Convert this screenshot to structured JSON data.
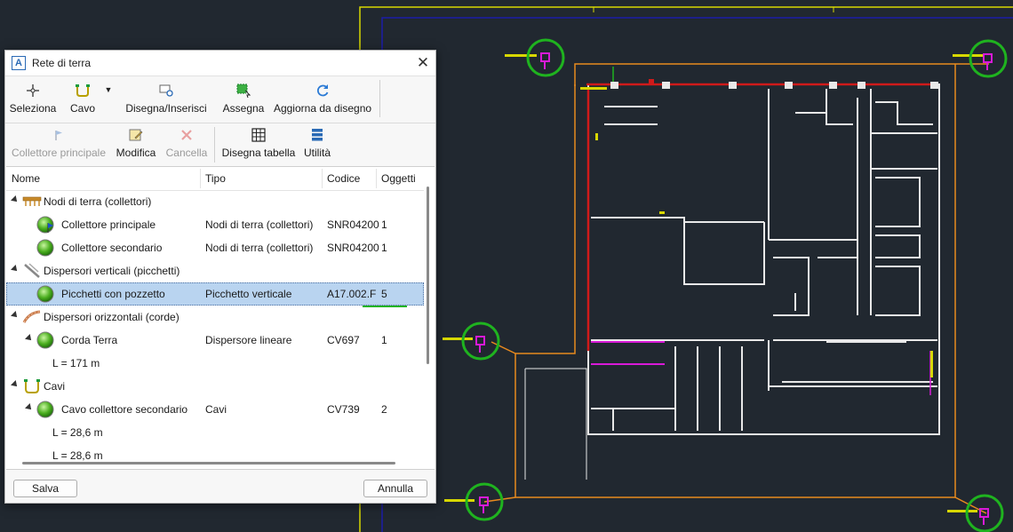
{
  "dialog": {
    "title": "Rete di terra",
    "app_icon_letter": "A"
  },
  "toolbar1": {
    "select_label": "Seleziona",
    "cable_label": "Cavo",
    "draw_insert_label": "Disegna/Inserisci",
    "assign_label": "Assegna",
    "update_label": "Aggiorna da disegno"
  },
  "toolbar2": {
    "main_collector_label": "Collettore principale",
    "edit_label": "Modifica",
    "delete_label": "Cancella",
    "draw_table_label": "Disegna tabella",
    "utility_label": "Utilità"
  },
  "grid": {
    "columns": [
      "Nome",
      "Tipo",
      "Codice",
      "Oggetti"
    ],
    "rows": [
      {
        "level": 0,
        "name": "Nodi di terra (collettori)",
        "tipo": "",
        "codice": "",
        "oggetti": "",
        "icon": "collector-bar-icon",
        "expandable": true
      },
      {
        "level": 1,
        "name": "Collettore principale",
        "tipo": "Nodi di terra (collettori)",
        "codice": "SNR04200",
        "oggetti": "1",
        "icon": "green-ball-flag-icon",
        "expandable": false
      },
      {
        "level": 1,
        "name": "Collettore secondario",
        "tipo": "Nodi di terra (collettori)",
        "codice": "SNR04200",
        "oggetti": "1",
        "icon": "green-ball-icon",
        "expandable": false
      },
      {
        "level": 0,
        "name": "Dispersori verticali (picchetti)",
        "tipo": "",
        "codice": "",
        "oggetti": "",
        "icon": "stake-icon",
        "expandable": true
      },
      {
        "level": 1,
        "name": "Picchetti con pozzetto",
        "tipo": "Picchetto verticale",
        "codice": "A17.002.F",
        "oggetti": "5",
        "icon": "green-ball-icon",
        "expandable": false,
        "selected": true
      },
      {
        "level": 0,
        "name": "Dispersori orizzontali (corde)",
        "tipo": "",
        "codice": "",
        "oggetti": "",
        "icon": "rope-icon",
        "expandable": true
      },
      {
        "level": 1,
        "name": "Corda Terra",
        "tipo": "Dispersore lineare",
        "codice": "CV697",
        "oggetti": "1",
        "icon": "green-ball-icon",
        "expandable": true
      },
      {
        "level": 2,
        "name": "L = 171 m",
        "tipo": "",
        "codice": "",
        "oggetti": "",
        "icon": "",
        "expandable": false
      },
      {
        "level": 0,
        "name": "Cavi",
        "tipo": "",
        "codice": "",
        "oggetti": "",
        "icon": "cable-u-icon",
        "expandable": true
      },
      {
        "level": 1,
        "name": "Cavo collettore secondario",
        "tipo": "Cavi",
        "codice": "CV739",
        "oggetti": "2",
        "icon": "green-ball-icon",
        "expandable": true
      },
      {
        "level": 2,
        "name": "L = 28,6 m",
        "tipo": "",
        "codice": "",
        "oggetti": "",
        "icon": "",
        "expandable": false
      },
      {
        "level": 2,
        "name": "L = 28,6 m",
        "tipo": "",
        "codice": "",
        "oggetti": "",
        "icon": "",
        "expandable": false
      }
    ]
  },
  "footer": {
    "save_label": "Salva",
    "cancel_label": "Annulla"
  },
  "colors": {
    "canvas_bg": "#212830",
    "selection": "#b9d4f0",
    "highlight_circle": "#1fb31f",
    "frame_yellow": "#d8d800",
    "frame_blue": "#1c1ca8",
    "earth_rope": "#e88a1e",
    "walls": "#e8e8e8",
    "red_line": "#d01a1a",
    "magenta": "#d81ad8"
  }
}
